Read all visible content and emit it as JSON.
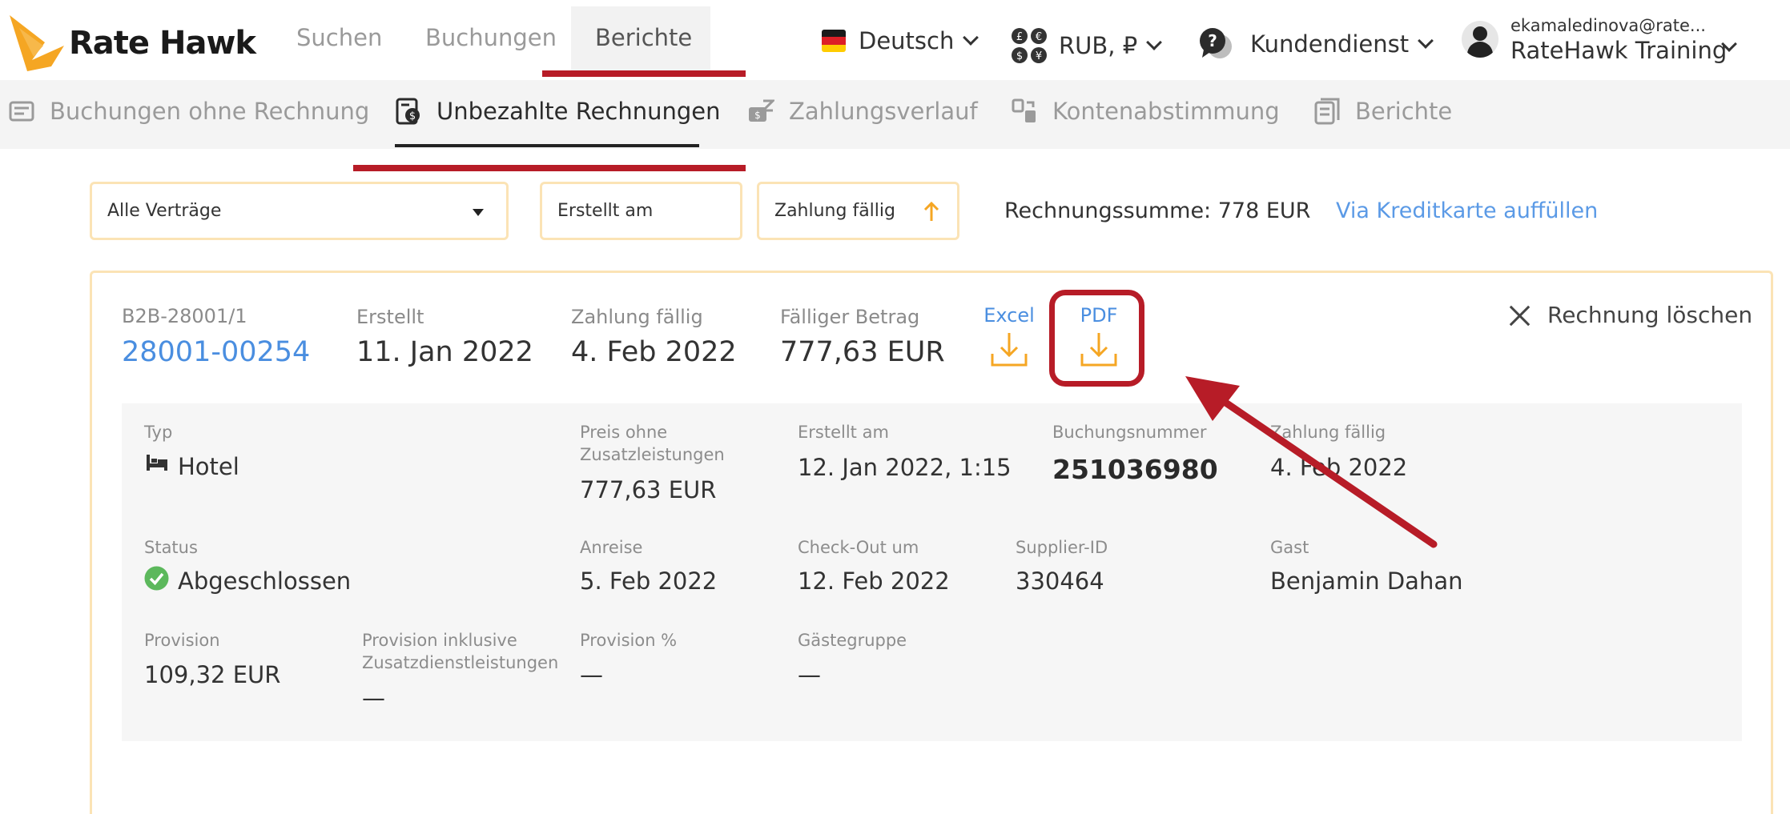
{
  "header": {
    "logo_text": "Rate Hawk",
    "nav": [
      "Suchen",
      "Buchungen",
      "Berichte"
    ],
    "language": "Deutsch",
    "currency": "RUB, ₽",
    "support": "Kundendienst",
    "user_email": "ekamaledinova@rate...",
    "user_name": "RateHawk Training"
  },
  "subnav": {
    "items": [
      "Buchungen ohne Rechnung",
      "Unbezahlte Rechnungen",
      "Zahlungsverlauf",
      "Kontenabstimmung",
      "Berichte"
    ]
  },
  "filters": {
    "contracts": "Alle Verträge",
    "created": "Erstellt am",
    "due": "Zahlung fällig",
    "sum_text": "Rechnungssumme: 778 EUR",
    "topup_link": "Via Kreditkarte auffüllen"
  },
  "invoice": {
    "contract_id": "B2B-28001/1",
    "number": "28001-00254",
    "created_label": "Erstellt",
    "created": "11. Jan 2022",
    "due_label": "Zahlung fällig",
    "due": "4. Feb 2022",
    "amount_label": "Fälliger Betrag",
    "amount": "777,63 EUR",
    "excel": "Excel",
    "pdf": "PDF",
    "delete": "Rechnung löschen"
  },
  "details": {
    "type_label": "Typ",
    "type": "Hotel",
    "price_label_1": "Preis ohne",
    "price_label_2": "Zusatzleistungen",
    "price": "777,63 EUR",
    "created_label": "Erstellt am",
    "created": "12. Jan 2022, 1:15",
    "booking_label": "Buchungsnummer",
    "booking": "251036980",
    "due_label": "Zahlung fällig",
    "due": "4. Feb 2022",
    "status_label": "Status",
    "status": "Abgeschlossen",
    "arrival_label": "Anreise",
    "arrival": "5. Feb 2022",
    "checkout_label": "Check-Out um",
    "checkout": "12. Feb 2022",
    "supplier_label": "Supplier-ID",
    "supplier": "330464",
    "guest_label": "Gast",
    "guest": "Benjamin Dahan",
    "commission_label": "Provision",
    "commission": "109,32 EUR",
    "commission_incl_label_1": "Provision inklusive",
    "commission_incl_label_2": "Zusatzdienstleistungen",
    "commission_incl": "—",
    "commission_pct_label": "Provision %",
    "commission_pct": "—",
    "guest_group_label": "Gästegruppe",
    "guest_group": "—"
  },
  "colors": {
    "accent_orange": "#f5a623",
    "link_blue": "#4a8ee0",
    "annotation_red": "#b71c27",
    "status_green": "#5cb85c"
  }
}
